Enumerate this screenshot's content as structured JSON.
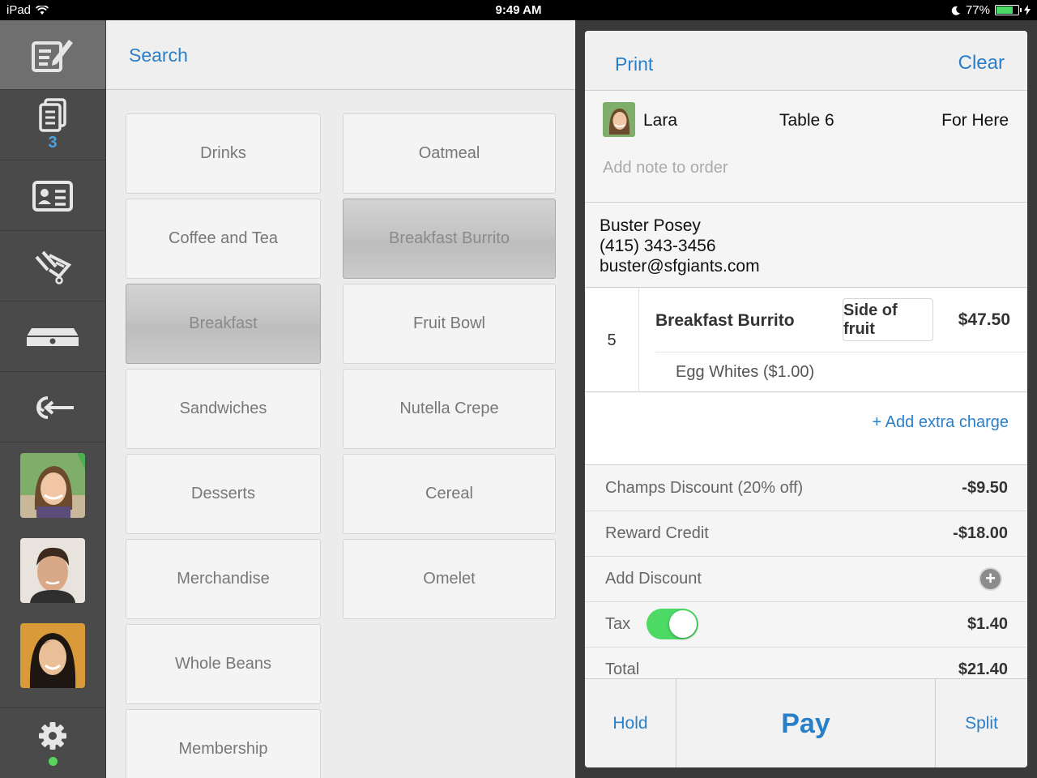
{
  "status_bar": {
    "device": "iPad",
    "time": "9:49 AM",
    "battery": "77%",
    "battery_level": 0.77
  },
  "rail": {
    "items": [
      {
        "icon": "edit-order-icon",
        "badge": ""
      },
      {
        "icon": "orders-icon",
        "badge": "3"
      },
      {
        "icon": "customer-card-icon",
        "badge": ""
      },
      {
        "icon": "items-icon",
        "badge": ""
      },
      {
        "icon": "cash-drawer-icon",
        "badge": ""
      },
      {
        "icon": "clock-out-icon",
        "badge": ""
      }
    ],
    "avatars": [
      "employee-avatar-1",
      "employee-avatar-2",
      "employee-avatar-3"
    ],
    "settings_icon": "gear-icon"
  },
  "catalog": {
    "search_label": "Search",
    "left_column": [
      "Drinks",
      "Coffee and Tea",
      "Breakfast",
      "Sandwiches",
      "Desserts",
      "Merchandise",
      "Whole Beans",
      "Membership"
    ],
    "right_column": [
      "Oatmeal",
      "Breakfast Burrito",
      "Fruit Bowl",
      "Nutella Crepe",
      "Cereal",
      "Omelet"
    ],
    "selected": [
      "Breakfast",
      "Breakfast Burrito"
    ]
  },
  "order": {
    "print_label": "Print",
    "clear_label": "Clear",
    "server_name": "Lara",
    "table": "Table 6",
    "service_type": "For Here",
    "note_placeholder": "Add note to order",
    "customer": {
      "name": "Buster Posey",
      "phone": "(415) 343-3456",
      "email": "buster@sfgiants.com"
    },
    "line_item": {
      "quantity": "5",
      "name": "Breakfast Burrito",
      "option": "Side of fruit",
      "price": "$47.50",
      "modifier": "Egg Whites ($1.00)"
    },
    "add_extra_charge": "+ Add extra charge",
    "summary": {
      "discount_label": "Champs Discount (20% off)",
      "discount_value": "-$9.50",
      "reward_label": "Reward Credit",
      "reward_value": "-$18.00",
      "add_discount_label": "Add Discount",
      "tax_label": "Tax",
      "tax_enabled": true,
      "tax_value": "$1.40",
      "total_label": "Total",
      "total_value": "$21.40"
    },
    "actions": {
      "hold": "Hold",
      "pay": "Pay",
      "split": "Split"
    }
  },
  "colors": {
    "accent": "#2a7fc9",
    "toggle_on": "#4cd964",
    "rail_bg": "#4a4a4a",
    "online_dot": "#59d35a"
  }
}
